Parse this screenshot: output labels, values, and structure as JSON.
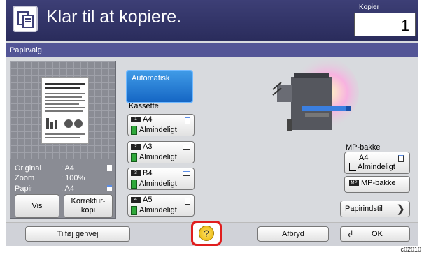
{
  "header": {
    "status_message": "Klar til at kopiere.",
    "copies_label": "Kopier",
    "copies_value": "1"
  },
  "screen_title": "Papirvalg",
  "preview": {
    "original_label": "Original",
    "original_value": ": A4",
    "zoom_label": "Zoom",
    "zoom_value": ": 100%",
    "paper_label": "Papir",
    "paper_value": ": A4",
    "view_button": "Vis",
    "proof_button": "Korrektur-\nkopi"
  },
  "auto_button": "Automatisk",
  "cassette_heading": "Kassette",
  "cassettes": [
    {
      "num": "1",
      "size": "A4",
      "type": "Almindeligt"
    },
    {
      "num": "2",
      "size": "A3",
      "type": "Almindeligt"
    },
    {
      "num": "3",
      "size": "B4",
      "type": "Almindeligt"
    },
    {
      "num": "4",
      "size": "A5",
      "type": "Almindeligt"
    }
  ],
  "mp": {
    "heading": "MP-bakke",
    "size": "A4",
    "type": "Almindeligt",
    "tray_button": "MP-bakke",
    "settings_button": "Papirindstil"
  },
  "bottom": {
    "shortcut_button": "Tilføj genvej",
    "help_label": "?",
    "cancel_button": "Afbryd",
    "ok_button": "OK"
  },
  "figure_code": "c02010"
}
